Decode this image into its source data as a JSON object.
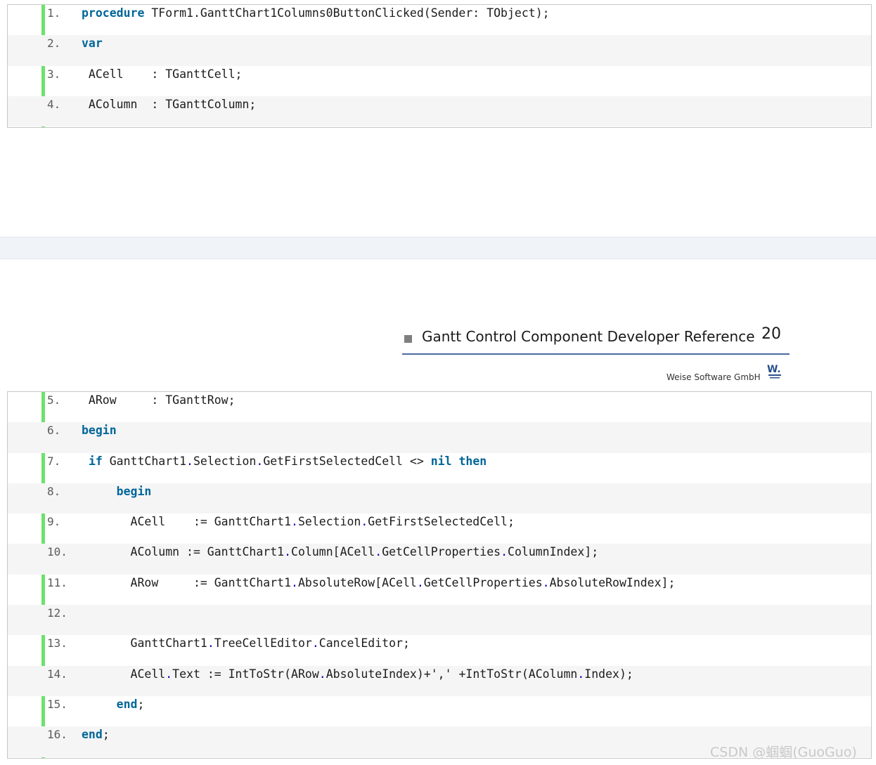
{
  "page_top": {
    "lines": [
      {
        "n": "1.",
        "parts": [
          {
            "t": "procedure",
            "k": "kw"
          },
          {
            "t": " TForm1.GanttChart1Columns0ButtonClicked(Sender: TObject);",
            "k": ""
          }
        ]
      },
      {
        "n": "2.",
        "parts": [
          {
            "t": "var",
            "k": "kw"
          }
        ]
      },
      {
        "n": "3.",
        "parts": [
          {
            "t": " ACell    : TGanttCell;",
            "k": ""
          }
        ]
      },
      {
        "n": "4.",
        "parts": [
          {
            "t": " AColumn  : TGanttColumn;",
            "k": ""
          }
        ]
      }
    ]
  },
  "header": {
    "title": "Gantt Control Component Developer Reference",
    "page_number": "20",
    "company": "Weise Software GmbH",
    "logo_text": "W."
  },
  "page_bottom": {
    "lines": [
      {
        "n": "5.",
        "parts": [
          {
            "t": " ARow     : TGanttRow;",
            "k": ""
          }
        ]
      },
      {
        "n": "6.",
        "parts": [
          {
            "t": "begin",
            "k": "kw"
          }
        ]
      },
      {
        "n": "7.",
        "parts": [
          {
            "t": " ",
            "k": ""
          },
          {
            "t": "if",
            "k": "kw"
          },
          {
            "t": " GanttChart1",
            "k": ""
          },
          {
            "t": ".",
            "k": "pu"
          },
          {
            "t": "Selection",
            "k": ""
          },
          {
            "t": ".",
            "k": "pu"
          },
          {
            "t": "GetFirstSelectedCell <> ",
            "k": ""
          },
          {
            "t": "nil",
            "k": "kw"
          },
          {
            "t": " ",
            "k": ""
          },
          {
            "t": "then",
            "k": "kw"
          }
        ]
      },
      {
        "n": "8.",
        "parts": [
          {
            "t": "     ",
            "k": ""
          },
          {
            "t": "begin",
            "k": "kw"
          }
        ]
      },
      {
        "n": "9.",
        "parts": [
          {
            "t": "       ACell    := GanttChart1",
            "k": ""
          },
          {
            "t": ".",
            "k": "pu"
          },
          {
            "t": "Selection",
            "k": ""
          },
          {
            "t": ".",
            "k": "pu"
          },
          {
            "t": "GetFirstSelectedCell;",
            "k": ""
          }
        ]
      },
      {
        "n": "10.",
        "parts": [
          {
            "t": "       AColumn := GanttChart1",
            "k": ""
          },
          {
            "t": ".",
            "k": "pu"
          },
          {
            "t": "Column[ACell",
            "k": ""
          },
          {
            "t": ".",
            "k": "pu"
          },
          {
            "t": "GetCellProperties",
            "k": ""
          },
          {
            "t": ".",
            "k": "pu"
          },
          {
            "t": "ColumnIndex];",
            "k": ""
          }
        ]
      },
      {
        "n": "11.",
        "parts": [
          {
            "t": "       ARow     := GanttChart1",
            "k": ""
          },
          {
            "t": ".",
            "k": "pu"
          },
          {
            "t": "AbsoluteRow[ACell",
            "k": ""
          },
          {
            "t": ".",
            "k": "pu"
          },
          {
            "t": "GetCellProperties",
            "k": ""
          },
          {
            "t": ".",
            "k": "pu"
          },
          {
            "t": "AbsoluteRowIndex];",
            "k": ""
          }
        ]
      },
      {
        "n": "12.",
        "parts": []
      },
      {
        "n": "13.",
        "parts": [
          {
            "t": "       GanttChart1",
            "k": ""
          },
          {
            "t": ".",
            "k": "pu"
          },
          {
            "t": "TreeCellEditor",
            "k": ""
          },
          {
            "t": ".",
            "k": "pu"
          },
          {
            "t": "CancelEditor;",
            "k": ""
          }
        ]
      },
      {
        "n": "14.",
        "parts": [
          {
            "t": "       ACell",
            "k": ""
          },
          {
            "t": ".",
            "k": "pu"
          },
          {
            "t": "Text := IntToStr(ARow",
            "k": ""
          },
          {
            "t": ".",
            "k": "pu"
          },
          {
            "t": "AbsoluteIndex)+',' +IntToStr(AColumn",
            "k": ""
          },
          {
            "t": ".",
            "k": "pu"
          },
          {
            "t": "Index);",
            "k": ""
          }
        ]
      },
      {
        "n": "15.",
        "parts": [
          {
            "t": "     ",
            "k": ""
          },
          {
            "t": "end",
            "k": "kw"
          },
          {
            "t": ";",
            "k": ""
          }
        ]
      },
      {
        "n": "16.",
        "parts": [
          {
            "t": "end",
            "k": "kw"
          },
          {
            "t": ";",
            "k": ""
          }
        ]
      }
    ]
  },
  "watermark": "CSDN @蝈蝈(GuoGuo)"
}
